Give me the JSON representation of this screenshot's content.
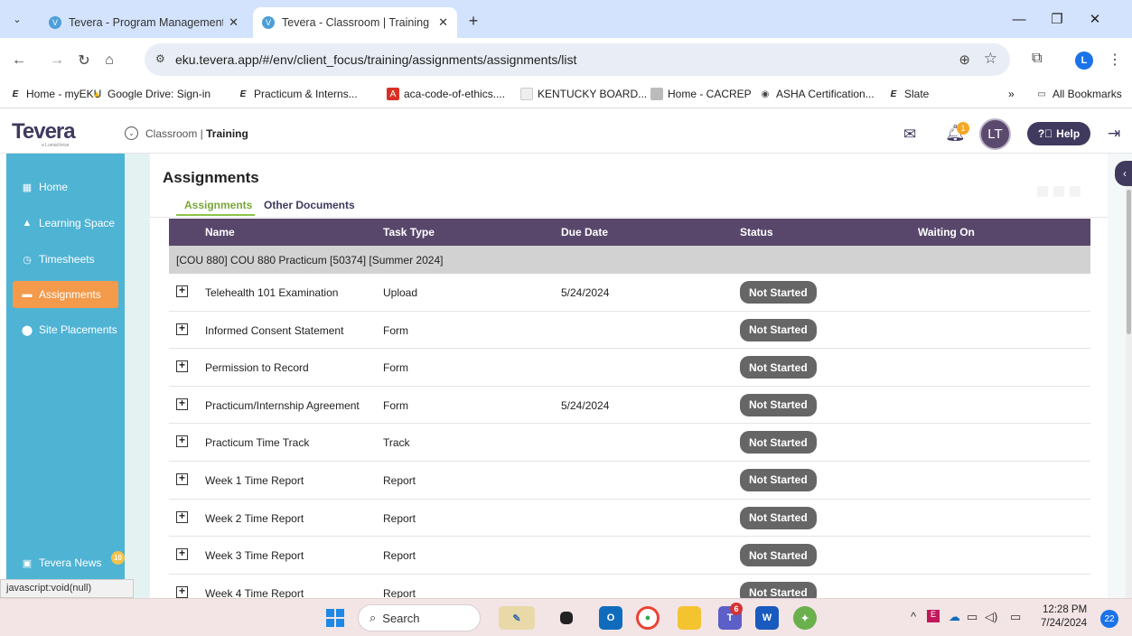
{
  "browser": {
    "tabs": [
      {
        "title": "Tevera - Program Management",
        "close": "✕"
      },
      {
        "title": "Tevera - Classroom | Training - E",
        "close": "✕"
      }
    ],
    "new_tab": "+",
    "url": "eku.tevera.app/#/env/client_focus/training/assignments/assignments/list",
    "profile_initial": "L",
    "bookmarks": [
      "Home - myEKU",
      "Google Drive: Sign-in",
      "Practicum & Interns...",
      "aca-code-of-ethics....",
      "KENTUCKY BOARD...",
      "Home - CACREP",
      "ASHA Certification...",
      "Slate"
    ],
    "bookmarks_overflow": "»",
    "all_bookmarks": "All Bookmarks"
  },
  "app": {
    "logo": "Tevera",
    "logo_sub": "a LumiaVerse",
    "context_prefix": "Classroom | ",
    "context_current": "Training",
    "bell_count": "1",
    "avatar_initials": "LT",
    "help_label": "Help"
  },
  "sidebar": {
    "items": [
      {
        "label": "Home",
        "icon": "grid-icon"
      },
      {
        "label": "Learning Space",
        "icon": "graduation-cap-icon"
      },
      {
        "label": "Timesheets",
        "icon": "stopwatch-icon"
      },
      {
        "label": "Assignments",
        "icon": "folder-icon"
      },
      {
        "label": "Site Placements",
        "icon": "map-pin-icon"
      }
    ],
    "news_label": "Tevera News",
    "news_count": "10"
  },
  "status_bar_url": "javascript:void(null)",
  "main": {
    "title": "Assignments",
    "tabs": [
      "Assignments",
      "Other Documents"
    ],
    "columns": [
      "Name",
      "Task Type",
      "Due Date",
      "Status",
      "Waiting On"
    ],
    "group": "[COU 880] COU 880 Practicum [50374] [Summer 2024]",
    "rows": [
      {
        "name": "Telehealth 101 Examination",
        "type": "Upload",
        "due": "5/24/2024",
        "status": "Not Started"
      },
      {
        "name": "Informed Consent Statement",
        "type": "Form",
        "due": "",
        "status": "Not Started"
      },
      {
        "name": "Permission to Record",
        "type": "Form",
        "due": "",
        "status": "Not Started"
      },
      {
        "name": "Practicum/Internship Agreement",
        "type": "Form",
        "due": "5/24/2024",
        "status": "Not Started"
      },
      {
        "name": "Practicum Time Track",
        "type": "Track",
        "due": "",
        "status": "Not Started"
      },
      {
        "name": "Week 1 Time Report",
        "type": "Report",
        "due": "",
        "status": "Not Started"
      },
      {
        "name": "Week 2 Time Report",
        "type": "Report",
        "due": "",
        "status": "Not Started"
      },
      {
        "name": "Week 3 Time Report",
        "type": "Report",
        "due": "",
        "status": "Not Started"
      },
      {
        "name": "Week 4 Time Report",
        "type": "Report",
        "due": "",
        "status": "Not Started"
      }
    ]
  },
  "taskbar": {
    "search_label": "Search",
    "teams_badge": "6",
    "time": "12:28 PM",
    "date": "7/24/2024",
    "notifications": "22"
  },
  "colors": {
    "sidebar": "#4fb3d4",
    "active_nav": "#f39a4b",
    "table_header": "#58476b",
    "brand": "#3f3a5e",
    "status_badge": "#666666",
    "active_tab": "#7aa63a"
  }
}
